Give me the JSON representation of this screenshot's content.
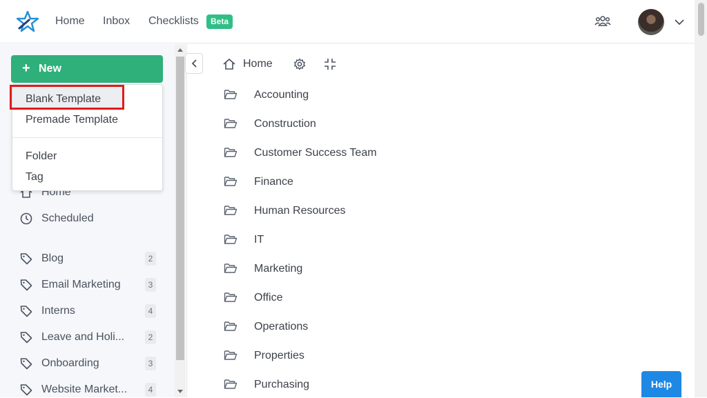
{
  "topbar": {
    "nav": [
      {
        "label": "Home"
      },
      {
        "label": "Inbox"
      },
      {
        "label": "Checklists"
      }
    ],
    "beta_badge": "Beta",
    "icons": {
      "logo": "star-logo",
      "team": "team-icon",
      "avatar": "user-avatar",
      "chevron": "chevron-down-icon"
    }
  },
  "sidebar": {
    "new_button": "New",
    "dropdown": {
      "items": [
        "Blank Template",
        "Premade Template",
        "Folder",
        "Tag"
      ]
    },
    "nav": [
      {
        "label": "Home",
        "icon": "home-icon"
      },
      {
        "label": "Scheduled",
        "icon": "clock-icon"
      }
    ],
    "tags": [
      {
        "label": "Blog",
        "count": "2"
      },
      {
        "label": "Email Marketing",
        "count": "3"
      },
      {
        "label": "Interns",
        "count": "4"
      },
      {
        "label": "Leave and Holi...",
        "count": "2"
      },
      {
        "label": "Onboarding",
        "count": "3"
      },
      {
        "label": "Website Market...",
        "count": "4"
      }
    ]
  },
  "main": {
    "breadcrumb": "Home",
    "folders": [
      "Accounting",
      "Construction",
      "Customer Success Team",
      "Finance",
      "Human Resources",
      "IT",
      "Marketing",
      "Office",
      "Operations",
      "Properties",
      "Purchasing"
    ]
  },
  "help_button": "Help",
  "colors": {
    "accent": "#2fb07a",
    "highlight": "#e01b1b",
    "help": "#1e88e5"
  }
}
